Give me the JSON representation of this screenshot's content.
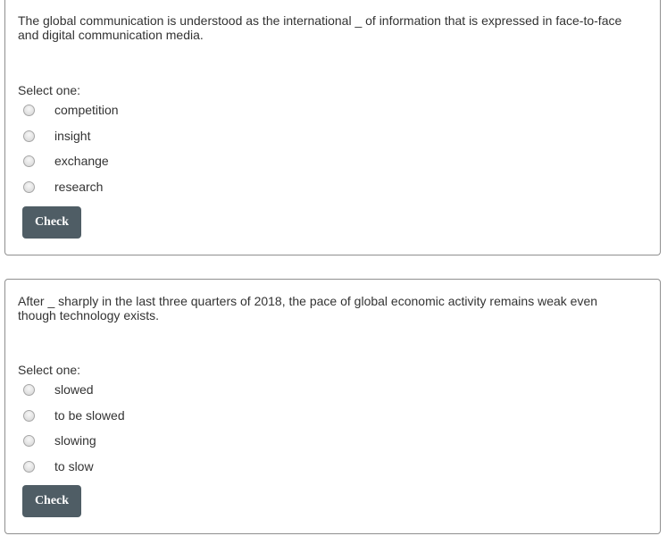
{
  "questions": [
    {
      "text": "The global communication is understood as the international _ of information that is expressed in face-to-face and digital communication media.",
      "select_label": "Select one:",
      "options": [
        "competition",
        "insight",
        "exchange",
        "research"
      ],
      "check_label": "Check"
    },
    {
      "text": "After _ sharply in the last three quarters of 2018, the pace of global economic activity remains weak even though technology exists.",
      "select_label": "Select one:",
      "options": [
        "slowed",
        "to be slowed",
        "slowing",
        "to slow"
      ],
      "check_label": "Check"
    }
  ],
  "colors": {
    "button_bg": "#4f5d65",
    "button_text": "#ffffff",
    "border": "#8f8f8f",
    "text": "#333333"
  }
}
